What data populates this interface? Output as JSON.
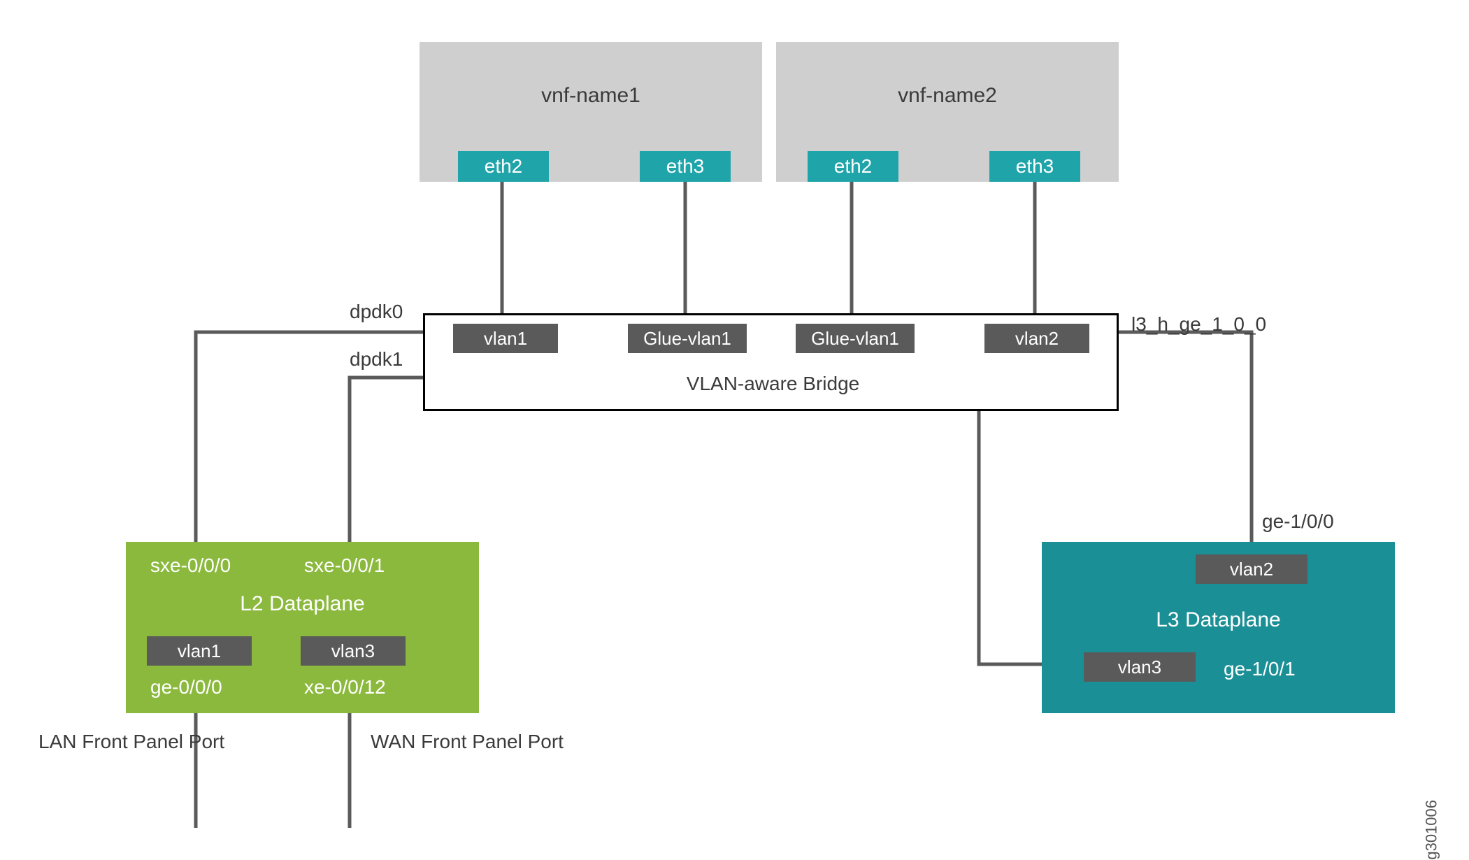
{
  "vnf1": {
    "title": "vnf-name1",
    "eth_left": "eth2",
    "eth_right": "eth3"
  },
  "vnf2": {
    "title": "vnf-name2",
    "eth_left": "eth2",
    "eth_right": "eth3"
  },
  "bridge": {
    "title": "VLAN-aware Bridge",
    "badges": {
      "b1": "vlan1",
      "b2": "Glue-vlan1",
      "b3": "Glue-vlan1",
      "b4": "vlan2"
    },
    "left_label_top": "dpdk0",
    "left_label_bottom": "dpdk1",
    "right_label": "l3_h_ge_1_0_0"
  },
  "l2": {
    "title": "L2 Dataplane",
    "sxe_left": "sxe-0/0/0",
    "sxe_right": "sxe-0/0/1",
    "vlan_left": "vlan1",
    "vlan_right": "vlan3",
    "ge_left": "ge-0/0/0",
    "xe_right": "xe-0/0/12"
  },
  "l3": {
    "title": "L3 Dataplane",
    "ge_top": "ge-1/0/0",
    "vlan_top": "vlan2",
    "vlan_bottom": "vlan3",
    "ge_bottom": "ge-1/0/1"
  },
  "footer": {
    "lan": "LAN Front Panel Port",
    "wan": "WAN Front Panel Port"
  },
  "figure_id": "g301006"
}
